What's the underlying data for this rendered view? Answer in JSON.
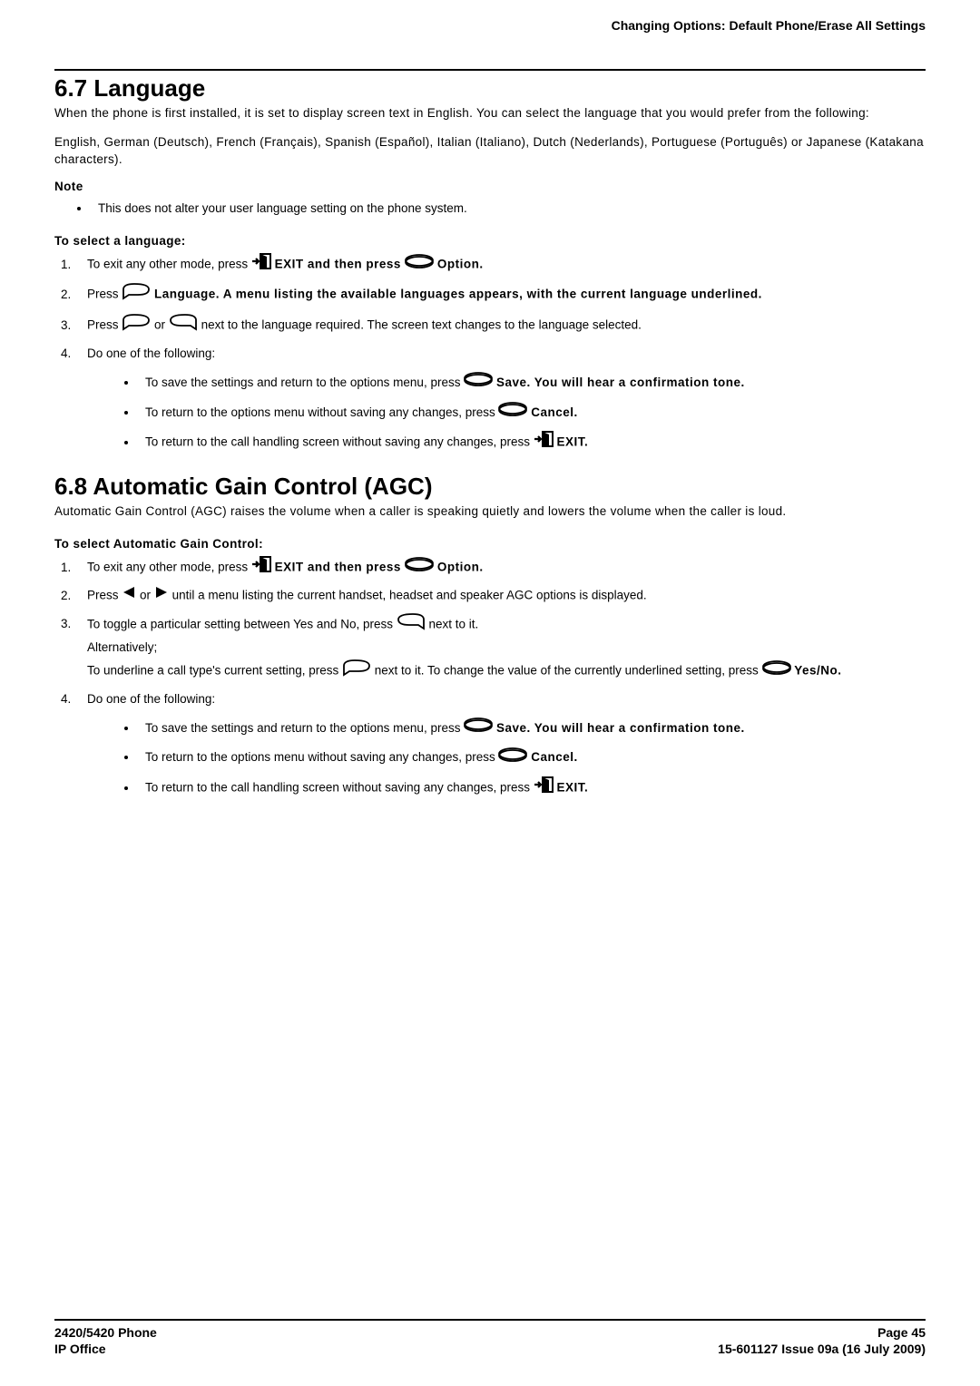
{
  "header": {
    "breadcrumb": "Changing Options: Default Phone/Erase All Settings"
  },
  "section67": {
    "title": "6.7 Language",
    "p1": "When the phone is first installed, it is set to display screen text in English. You can select the language that you would prefer from the following:",
    "p2": "English, German (Deutsch), French (Français), Spanish (Español), Italian (Italiano), Dutch (Nederlands), Portuguese (Português) or Japanese (Katakana characters).",
    "note_label": "Note",
    "note_item": "This does not alter your user language setting on the phone system.",
    "subhead": "To select a language:",
    "step1_a": "To exit any other mode, press ",
    "step1_b": " EXIT and then press ",
    "step1_c": " Option.",
    "step2_a": "Press ",
    "step2_b": " Language. A menu listing the available languages appears, with the current language underlined.",
    "step3_a": "Press ",
    "step3_b": " or ",
    "step3_c": " next to the language required. The screen text changes to the language selected.",
    "step4": "Do one of the following:",
    "step4_a_1": "To save the settings and return to the options menu, press ",
    "step4_a_2": " Save. You will hear a confirmation tone.",
    "step4_b_1": "To return to the options menu without saving any changes, press ",
    "step4_b_2": " Cancel.",
    "step4_c_1": "To return to the call handling screen without saving any changes, press ",
    "step4_c_2": " EXIT."
  },
  "section68": {
    "title": "6.8 Automatic Gain Control (AGC)",
    "p1": "Automatic Gain Control (AGC) raises the volume when a caller is speaking quietly and lowers the volume when the caller is loud.",
    "subhead": "To select Automatic Gain Control:",
    "step1_a": "To exit any other mode, press ",
    "step1_b": " EXIT and then press ",
    "step1_c": " Option.",
    "step2_a": "Press ",
    "step2_b": " or ",
    "step2_c": " until a menu listing the current handset, headset and speaker AGC options is displayed.",
    "step3_a": "To toggle a particular setting between Yes and No, press ",
    "step3_b": " next to it.",
    "step3_alt": "Alternatively;",
    "step3_c": "To underline a call type's current setting, press ",
    "step3_d": " next to it. To change the value of the currently underlined setting, press ",
    "step3_e": " Yes/No.",
    "step4": "Do one of the following:",
    "step4_a_1": "To save the settings and return to the options menu, press ",
    "step4_a_2": " Save. You will hear a confirmation tone.",
    "step4_b_1": "To return to the options menu without saving any changes, press ",
    "step4_b_2": " Cancel.",
    "step4_c_1": "To return to the call handling screen without saving any changes, press ",
    "step4_c_2": " EXIT."
  },
  "footer": {
    "left1": "2420/5420 Phone",
    "left2": "IP Office",
    "right1": "Page 45",
    "right2": "15-601127 Issue 09a (16 July 2009)"
  }
}
